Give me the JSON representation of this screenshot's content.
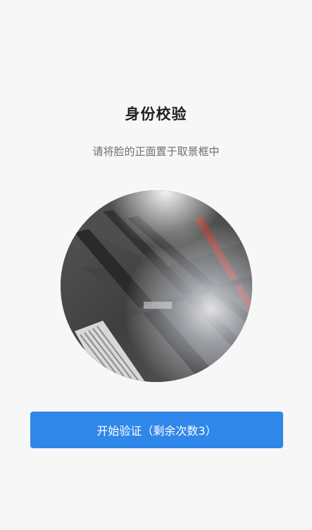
{
  "header": {
    "title": "身份校验",
    "instruction": "请将脸的正面置于取景框中"
  },
  "camera": {
    "icon": "camera-preview"
  },
  "actions": {
    "start_label": "开始验证（剩余次数3）"
  },
  "colors": {
    "background": "#f7f7f7",
    "primary": "#2f87e9",
    "title": "#1f1f1f",
    "subtitle": "#6f6f6f"
  }
}
